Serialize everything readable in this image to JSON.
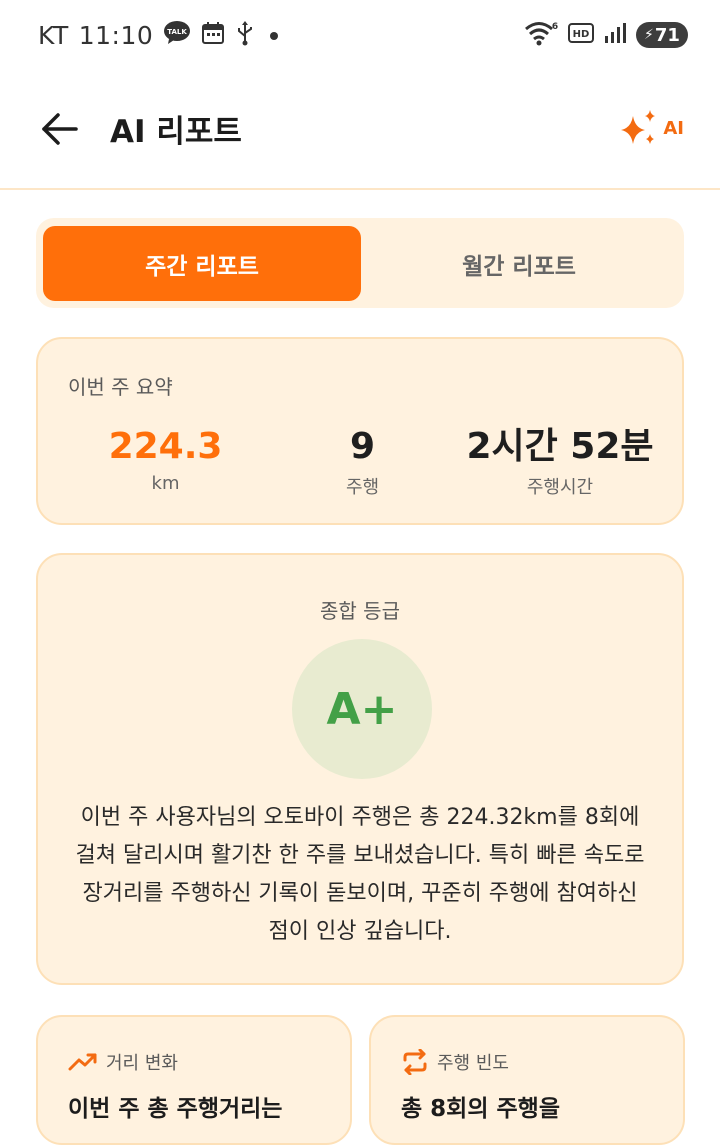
{
  "status_bar": {
    "carrier": "KT",
    "time": "11:10",
    "talk_badge": "TALK",
    "wifi_badge": "6",
    "hd_badge": "HD",
    "battery_level": "71"
  },
  "header": {
    "title": "AI 리포트",
    "ai_label": "AI"
  },
  "tabs": {
    "weekly": "주간 리포트",
    "monthly": "월간 리포트"
  },
  "summary": {
    "title": "이번 주 요약",
    "distance_value": "224.3",
    "distance_unit": "km",
    "rides_value": "9",
    "rides_label": "주행",
    "time_value": "2시간 52분",
    "time_label": "주행시간"
  },
  "grade": {
    "title": "종합 등급",
    "value": "A+",
    "description": "이번 주 사용자님의 오토바이 주행은 총 224.32km를 8회에 걸쳐 달리시며 활기찬 한 주를 보내셨습니다. 특히 빠른 속도로 장거리를 주행하신 기록이 돋보이며, 꾸준히 주행에 참여하신 점이 인상 깊습니다."
  },
  "cards": {
    "distance_change": {
      "label": "거리 변화",
      "body": "이번 주 총 주행거리는"
    },
    "ride_frequency": {
      "label": "주행 빈도",
      "body": "총 8회의 주행을"
    }
  },
  "colors": {
    "accent": "#ff6f0a",
    "grade_green": "#43a047",
    "card_bg": "#fff2df"
  },
  "icons": [
    "back-arrow-icon",
    "sparkle-icon",
    "trend-up-icon",
    "repeat-icon"
  ]
}
